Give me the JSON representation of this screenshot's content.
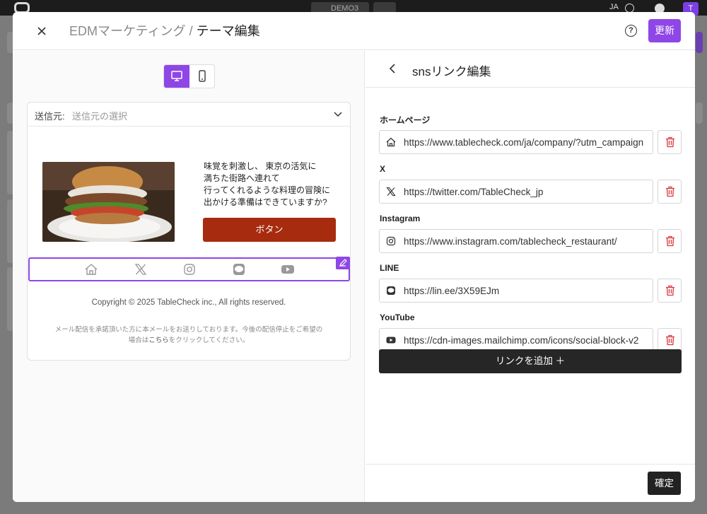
{
  "topbar": {
    "project": "DEMO3",
    "language": "JA",
    "avatar_initial": "T"
  },
  "modal": {
    "close_icon": "close-icon",
    "breadcrumb": "EDMマーケティング",
    "separator": "/",
    "title": "テーマ編集",
    "update_label": "更新"
  },
  "preview": {
    "sender_label": "送信元:",
    "sender_placeholder": "送信元の選択",
    "copy_lines": [
      "味覚を刺激し、 東京の活気に",
      "満ちた街路へ連れて",
      "行ってくれるような料理の冒険に",
      "出かける準備はできていますか?"
    ],
    "cta_label": "ボタン",
    "social_icons": [
      "home-icon",
      "x-icon",
      "instagram-icon",
      "line-icon",
      "youtube-icon"
    ],
    "copyright": "Copyright © 2025 TableCheck inc., All rights reserved.",
    "unsubscribe_line1": "メール配信を承諾頂いた方に本メールをお送りしております。今後の配信停止をご希望の",
    "unsubscribe_prefix": "場合は",
    "unsubscribe_link": "こちら",
    "unsubscribe_suffix": "をクリックしてください。"
  },
  "panel": {
    "title": "snsリンク編集",
    "links": [
      {
        "label": "ホームページ",
        "icon": "home-icon",
        "url": "https://www.tablecheck.com/ja/company/?utm_campaign"
      },
      {
        "label": "X",
        "icon": "x-icon",
        "url": "https://twitter.com/TableCheck_jp"
      },
      {
        "label": "Instagram",
        "icon": "instagram-icon",
        "url": "https://www.instagram.com/tablecheck_restaurant/"
      },
      {
        "label": "LINE",
        "icon": "line-icon",
        "url": "https://lin.ee/3X59EJm"
      },
      {
        "label": "YouTube",
        "icon": "youtube-icon",
        "url": "https://cdn-images.mailchimp.com/icons/social-block-v2"
      }
    ],
    "add_link_label": "リンクを追加 ＋",
    "confirm_label": "確定"
  },
  "colors": {
    "accent": "#8f46e6",
    "cta": "#a72b0e",
    "danger": "#d9363e",
    "dark": "#262626"
  }
}
